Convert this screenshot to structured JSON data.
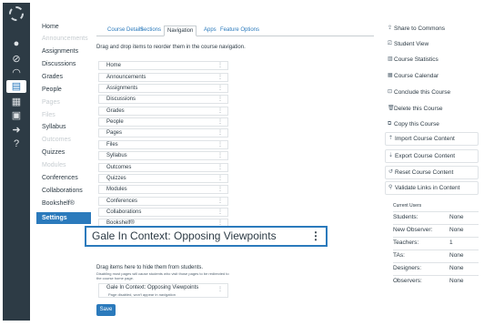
{
  "colors": {
    "nav_bg": "#2d3b45",
    "accent": "#2b7abc",
    "text": "#2d3b45",
    "muted": "#c7cdd1"
  },
  "global_nav": {
    "icons": [
      "logo-icon",
      "account-icon",
      "admin-icon",
      "dashboard-icon",
      "courses-icon",
      "calendar-icon",
      "inbox-icon",
      "commons-icon",
      "help-icon"
    ]
  },
  "course_nav": {
    "items": [
      {
        "label": "Home",
        "disabled": false
      },
      {
        "label": "Announcements",
        "disabled": true
      },
      {
        "label": "Assignments",
        "disabled": false
      },
      {
        "label": "Discussions",
        "disabled": false
      },
      {
        "label": "Grades",
        "disabled": false
      },
      {
        "label": "People",
        "disabled": false
      },
      {
        "label": "Pages",
        "disabled": true
      },
      {
        "label": "Files",
        "disabled": true
      },
      {
        "label": "Syllabus",
        "disabled": false
      },
      {
        "label": "Outcomes",
        "disabled": true
      },
      {
        "label": "Quizzes",
        "disabled": false
      },
      {
        "label": "Modules",
        "disabled": true
      },
      {
        "label": "Conferences",
        "disabled": false
      },
      {
        "label": "Collaborations",
        "disabled": false
      },
      {
        "label": "Bookshelf®",
        "disabled": false
      },
      {
        "label": "Settings",
        "disabled": false,
        "active": true
      }
    ]
  },
  "tabs": {
    "course_details": "Course Details",
    "sections": "Sections",
    "navigation": "Navigation",
    "apps": "Apps",
    "feature_options": "Feature Options"
  },
  "instructions": "Drag and drop items to reorder them in the course navigation.",
  "nav_list": [
    "Home",
    "Announcements",
    "Assignments",
    "Discussions",
    "Grades",
    "People",
    "Pages",
    "Files",
    "Syllabus",
    "Outcomes",
    "Quizzes",
    "Modules",
    "Conferences",
    "Collaborations",
    "Bookshelf®"
  ],
  "dragged_item": "Gale In Context: Opposing Viewpoints",
  "hidden_section": {
    "heading": "Drag items here to hide them from students.",
    "note": "Disabling most pages will cause students who visit those pages to be redirected to the course home page.",
    "item_label": "Gale In Context: Opposing Viewpoints",
    "item_sub": "Page disabled, won't appear in navigation"
  },
  "save_label": "Save",
  "sidebar": {
    "buttons": [
      {
        "label": "Share to Commons",
        "icon": "share-icon",
        "glyph": "⇪"
      },
      {
        "label": "Student View",
        "icon": "student-view-icon",
        "glyph": "⎚"
      },
      {
        "label": "Course Statistics",
        "icon": "stats-icon",
        "glyph": "▥"
      },
      {
        "label": "Course Calendar",
        "icon": "calendar-icon",
        "glyph": "▦"
      },
      {
        "label": "Conclude this Course",
        "icon": "lock-icon",
        "glyph": "⊡"
      },
      {
        "label": "Delete this Course",
        "icon": "trash-icon",
        "glyph": "🗑"
      },
      {
        "label": "Copy this Course",
        "icon": "copy-icon",
        "glyph": "⧉"
      },
      {
        "label": "Import Course Content",
        "icon": "import-icon",
        "glyph": "⇡"
      },
      {
        "label": "Export Course Content",
        "icon": "export-icon",
        "glyph": "⇣"
      },
      {
        "label": "Reset Course Content",
        "icon": "reset-icon",
        "glyph": "↺"
      },
      {
        "label": "Validate Links in Content",
        "icon": "link-icon",
        "glyph": "⚲"
      }
    ],
    "users_heading": "Current Users",
    "users": [
      {
        "role": "Students:",
        "count": "None"
      },
      {
        "role": "New Observer:",
        "count": "None"
      },
      {
        "role": "Teachers:",
        "count": "1"
      },
      {
        "role": "TAs:",
        "count": "None"
      },
      {
        "role": "Designers:",
        "count": "None"
      },
      {
        "role": "Observers:",
        "count": "None"
      }
    ]
  }
}
